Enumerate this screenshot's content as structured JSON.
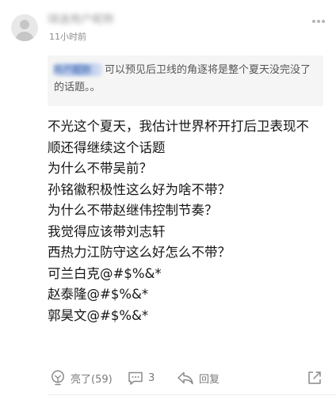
{
  "comment": {
    "username": "球迷用户昵称",
    "time": "11小时前",
    "quote": {
      "author": "用户昵称",
      "text": "可以预见后卫线的角逐将是整个夏天没完没了的话题。。"
    },
    "lines": [
      "不光这个夏天，我估计世界杯开打后卫表现不",
      "顺还得继续这个话题",
      "为什么不带吴前？",
      "孙铭徽积极性这么好为啥不带？",
      "为什么不带赵继伟控制节奏？",
      "我觉得应该带刘志轩",
      "西热力江防守这么好怎么不带？",
      "可兰白克@#$%&*",
      "赵泰隆@#$%&*",
      "郭昊文@#$%&*"
    ],
    "actions": {
      "like_label": "亮了(59)",
      "comment_count": "3",
      "reply_label": "回复"
    }
  },
  "icons": {
    "avatar": "default-avatar-icon",
    "more": "more-dots-icon",
    "like": "light-bulb-icon",
    "comment": "comment-bubble-icon",
    "reply": "reply-arrow-icon",
    "share": "share-icon"
  },
  "colors": {
    "primary_text": "#151515",
    "secondary_text": "#7a7a7a",
    "quote_background": "#f5f5f5"
  }
}
